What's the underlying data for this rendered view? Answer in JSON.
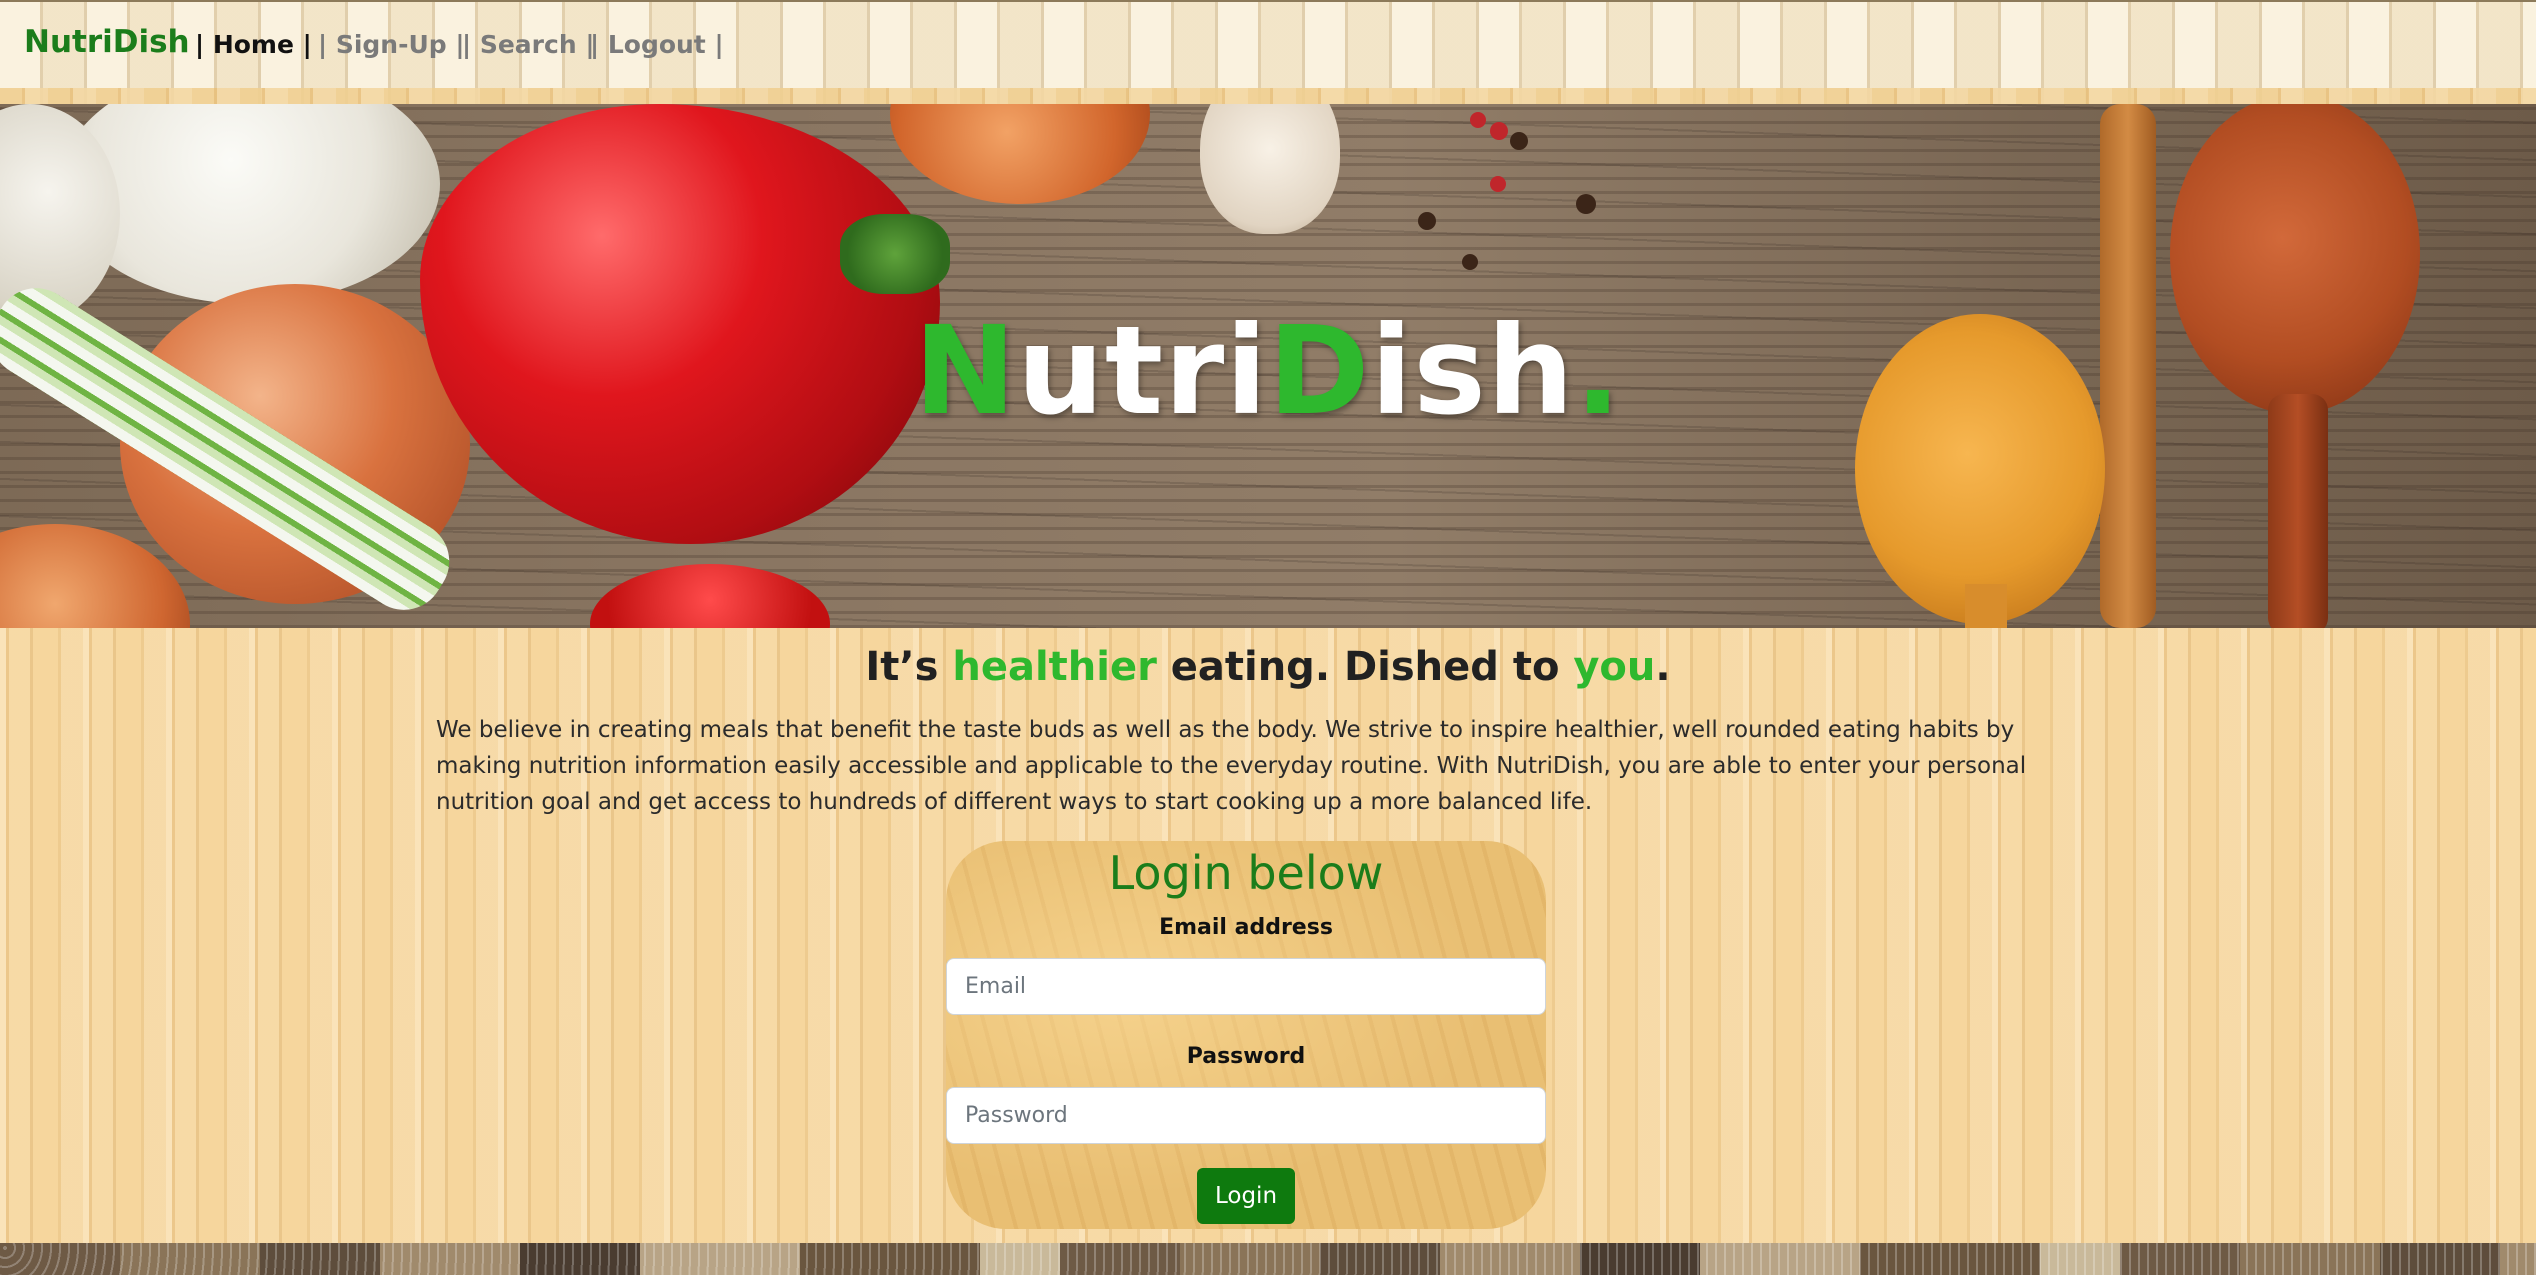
{
  "navbar": {
    "brand": "NutriDish",
    "links": [
      {
        "label": "| Home |",
        "active": true
      },
      {
        "label": "| Sign-Up |",
        "active": false
      },
      {
        "label": "| Search |",
        "active": false
      },
      {
        "label": "| Logout |",
        "active": false
      }
    ]
  },
  "hero": {
    "title_parts": [
      "N",
      "utri",
      "D",
      "ish",
      "."
    ]
  },
  "tagline": {
    "part1": "It’s ",
    "highlight1": "healthier",
    "part2": " eating. Dished to ",
    "highlight2": "you",
    "part3": "."
  },
  "about": "We believe in creating meals that benefit the taste buds as well as the body. We strive to inspire healthier, well rounded eating habits by making nutrition information easily accessible and applicable to the everyday routine. With NutriDish, you are able to enter your personal nutrition goal and get access to hundreds of different ways to start cooking up a more balanced life.",
  "login": {
    "title": "Login below",
    "email_label": "Email address",
    "email_placeholder": "Email",
    "email_value": "",
    "password_label": "Password",
    "password_placeholder": "Password",
    "password_value": "",
    "button_label": "Login"
  },
  "colors": {
    "brand_green": "#1b7d1b",
    "highlight_green": "#2eb82e",
    "button_green": "#0e7a0e"
  }
}
